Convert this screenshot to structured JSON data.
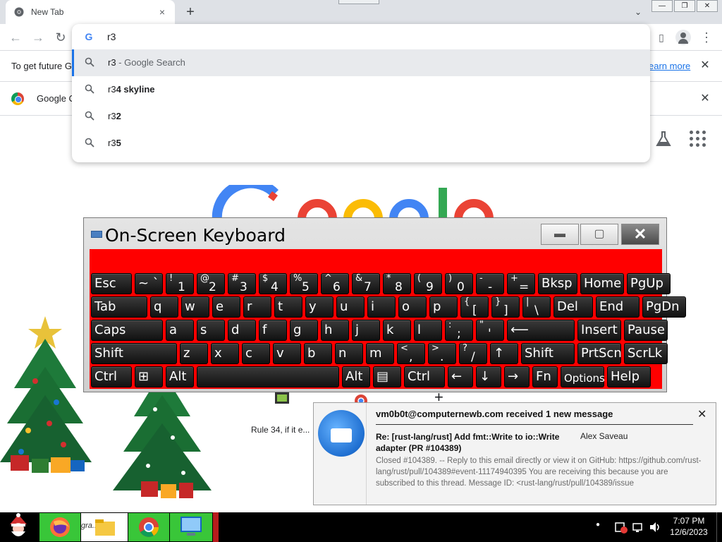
{
  "browser": {
    "tab_title": "New Tab",
    "tab_close": "×",
    "new_tab": "+",
    "tab_search": "⌄",
    "window_controls": [
      "—",
      "❐",
      "✕"
    ],
    "nav": {
      "back": "←",
      "forward": "→",
      "reload": "↻"
    },
    "omnibox": {
      "value": "r3",
      "suggestions": [
        {
          "typed": "r3",
          "bold": "",
          "suffix": " - Google Search",
          "selected": true
        },
        {
          "typed": "r3",
          "bold": "4 skyline",
          "suffix": "",
          "selected": false
        },
        {
          "typed": "r3",
          "bold": "2",
          "suffix": "",
          "selected": false
        },
        {
          "typed": "r3",
          "bold": "5",
          "suffix": "",
          "selected": false
        }
      ]
    },
    "toolbar_right": {
      "side_panel": "▯",
      "menu": "⋮"
    },
    "infobar_1": {
      "text": "To get future G",
      "link": "earn more",
      "close": "✕"
    },
    "infobar_2": {
      "text": "Google C",
      "close": "✕"
    },
    "shortcut_label": "Rule 34, if it e...",
    "tile_plus": "+"
  },
  "osk": {
    "title": "On-Screen Keyboard",
    "buttons": {
      "minimize": "▬",
      "maximize": "▢",
      "close": "✕"
    },
    "keys": [
      [
        {
          "k": "Esc"
        },
        {
          "k": "~ `",
          "t": "sub"
        },
        {
          "top": "!",
          "low": "1"
        },
        {
          "top": "@",
          "low": "2"
        },
        {
          "top": "#",
          "low": "3"
        },
        {
          "top": "$",
          "low": "4"
        },
        {
          "top": "%",
          "low": "5"
        },
        {
          "top": "^",
          "low": "6"
        },
        {
          "top": "&",
          "low": "7"
        },
        {
          "top": "*",
          "low": "8"
        },
        {
          "top": "(",
          "low": "9"
        },
        {
          "top": ")",
          "low": "0"
        },
        {
          "top": "-",
          "low": "-"
        },
        {
          "top": "+",
          "low": "="
        },
        {
          "k": "Bksp"
        },
        {
          "k": "Home"
        },
        {
          "k": "PgUp"
        }
      ],
      [
        {
          "k": "Tab"
        },
        {
          "k": "q"
        },
        {
          "k": "w"
        },
        {
          "k": "e"
        },
        {
          "k": "r"
        },
        {
          "k": "t"
        },
        {
          "k": "y"
        },
        {
          "k": "u"
        },
        {
          "k": "i"
        },
        {
          "k": "o"
        },
        {
          "k": "p"
        },
        {
          "top": "{",
          "low": "["
        },
        {
          "top": "}",
          "low": "]"
        },
        {
          "top": "|",
          "low": "\\"
        },
        {
          "k": "Del"
        },
        {
          "k": "End"
        },
        {
          "k": "PgDn"
        }
      ],
      [
        {
          "k": "Caps"
        },
        {
          "k": "a"
        },
        {
          "k": "s"
        },
        {
          "k": "d"
        },
        {
          "k": "f"
        },
        {
          "k": "g"
        },
        {
          "k": "h"
        },
        {
          "k": "j"
        },
        {
          "k": "k"
        },
        {
          "k": "l"
        },
        {
          "top": ":",
          "low": ";"
        },
        {
          "top": "\"",
          "low": "'"
        },
        {
          "k": "⟵"
        },
        {
          "k": "Insert"
        },
        {
          "k": "Pause"
        }
      ],
      [
        {
          "k": "Shift"
        },
        {
          "k": "z"
        },
        {
          "k": "x"
        },
        {
          "k": "c"
        },
        {
          "k": "v"
        },
        {
          "k": "b"
        },
        {
          "k": "n"
        },
        {
          "k": "m"
        },
        {
          "top": "<",
          "low": ","
        },
        {
          "top": ">",
          "low": "."
        },
        {
          "top": "?",
          "low": "/"
        },
        {
          "k": "↑"
        },
        {
          "k": "Shift"
        },
        {
          "k": "PrtScn"
        },
        {
          "k": "ScrLk"
        }
      ],
      [
        {
          "k": "Ctrl"
        },
        {
          "k": "⊞"
        },
        {
          "k": "Alt"
        },
        {
          "k": ""
        },
        {
          "k": "Alt"
        },
        {
          "k": "▤"
        },
        {
          "k": "Ctrl"
        },
        {
          "k": "←"
        },
        {
          "k": "↓"
        },
        {
          "k": "→"
        },
        {
          "k": "Fn"
        },
        {
          "k": "Options"
        },
        {
          "k": "Help"
        }
      ]
    ]
  },
  "notification": {
    "header": "vm0b0t@computernewb.com received 1 new message",
    "close": "✕",
    "subject": "Re: [rust-lang/rust] Add fmt::Write to io::Write adapter (PR #104389)",
    "from": "Alex Saveau",
    "body": "Closed #104389. -- Reply to this email directly or view it on GitHub: https://github.com/rust-lang/rust/pull/104389#event-11174940395 You are receiving this because you are subscribed to this thread. Message ID: <rust-lang/rust/pull/104389/issue"
  },
  "taskbar": {
    "items": [
      "start",
      "firefox",
      "file-explorer",
      "chrome",
      "network-app"
    ],
    "explorer_label": "gra...ed fi",
    "time": "7:07 PM",
    "date": "12/6/2023",
    "tray_dot": "●"
  },
  "colors": {
    "osk_key_area": "#ff0000",
    "taskbar_green": "#39c639",
    "chrome_blue": "#1a73e8"
  }
}
